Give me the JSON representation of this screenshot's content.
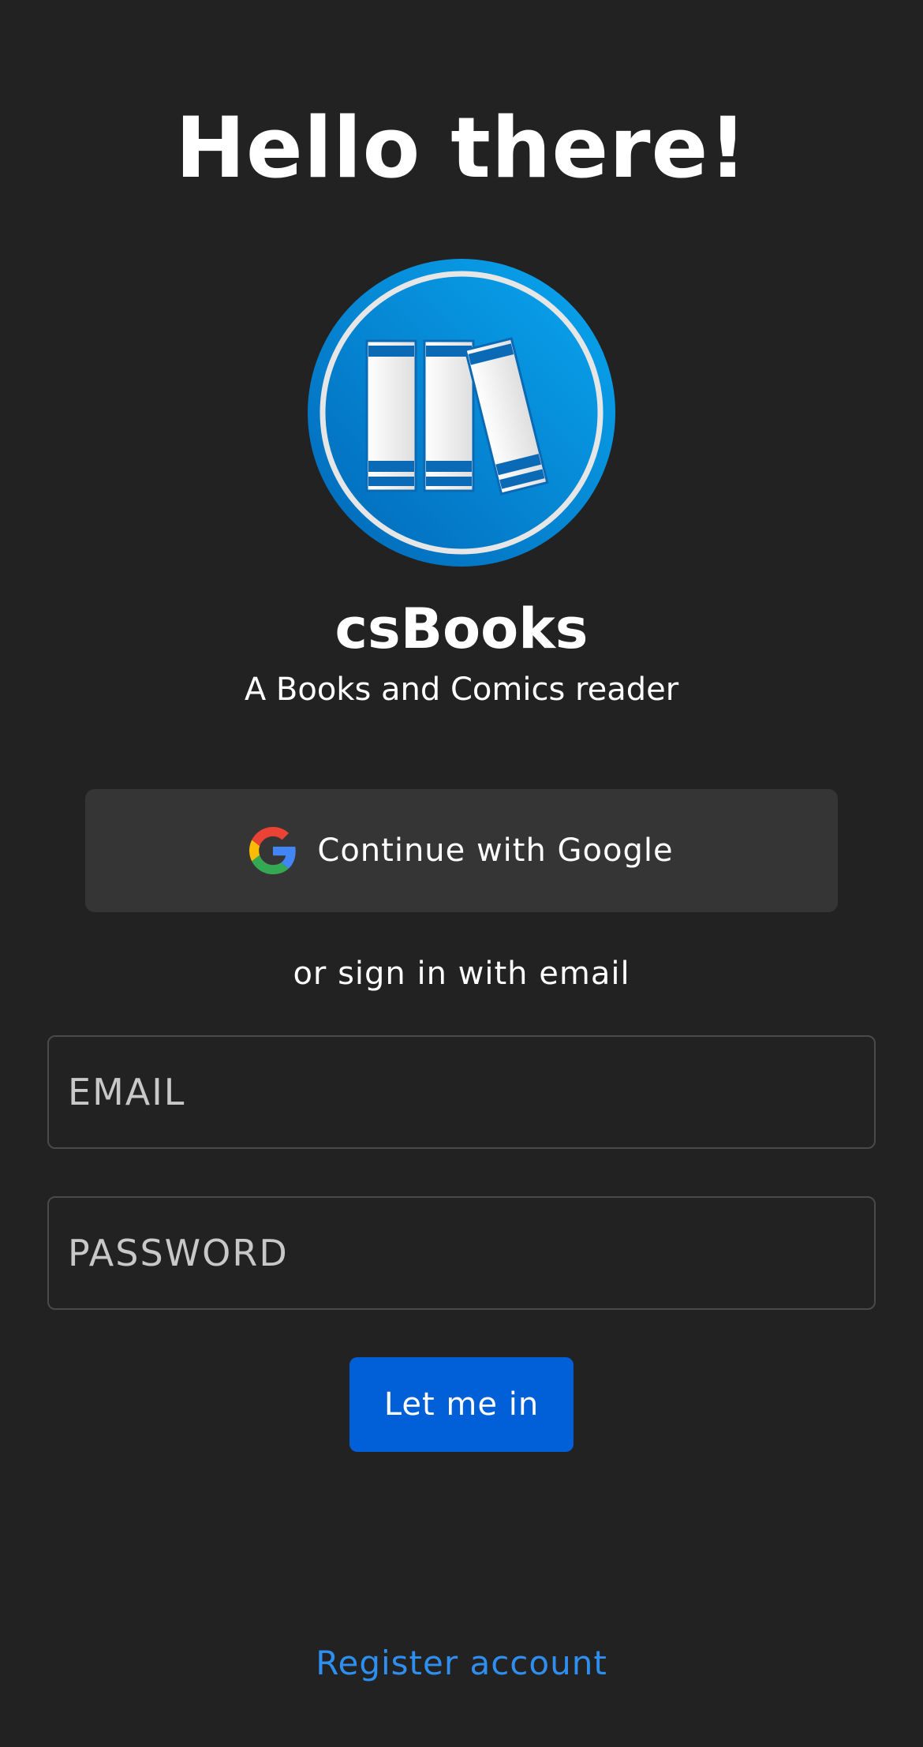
{
  "header": {
    "title": "Hello there!"
  },
  "app": {
    "name": "csBooks",
    "tagline": "A Books and Comics reader",
    "logo_icon": "bookshelf-logo-icon",
    "logo_colors": {
      "outer": "#0a8ee0",
      "book": "#f1f1f1",
      "band": "#0a6ab5"
    }
  },
  "auth": {
    "google_button_label": "Continue with Google",
    "google_icon": "google-g-icon",
    "divider_text": "or sign in with email",
    "email_placeholder": "EMAIL",
    "email_value": "",
    "password_placeholder": "PASSWORD",
    "password_value": "",
    "submit_label": "Let me in",
    "register_label": "Register account"
  },
  "colors": {
    "background": "#222222",
    "google_button_bg": "#353535",
    "primary_button": "#0160d7",
    "link": "#2f8ff0",
    "field_border": "#4a4a4a"
  }
}
